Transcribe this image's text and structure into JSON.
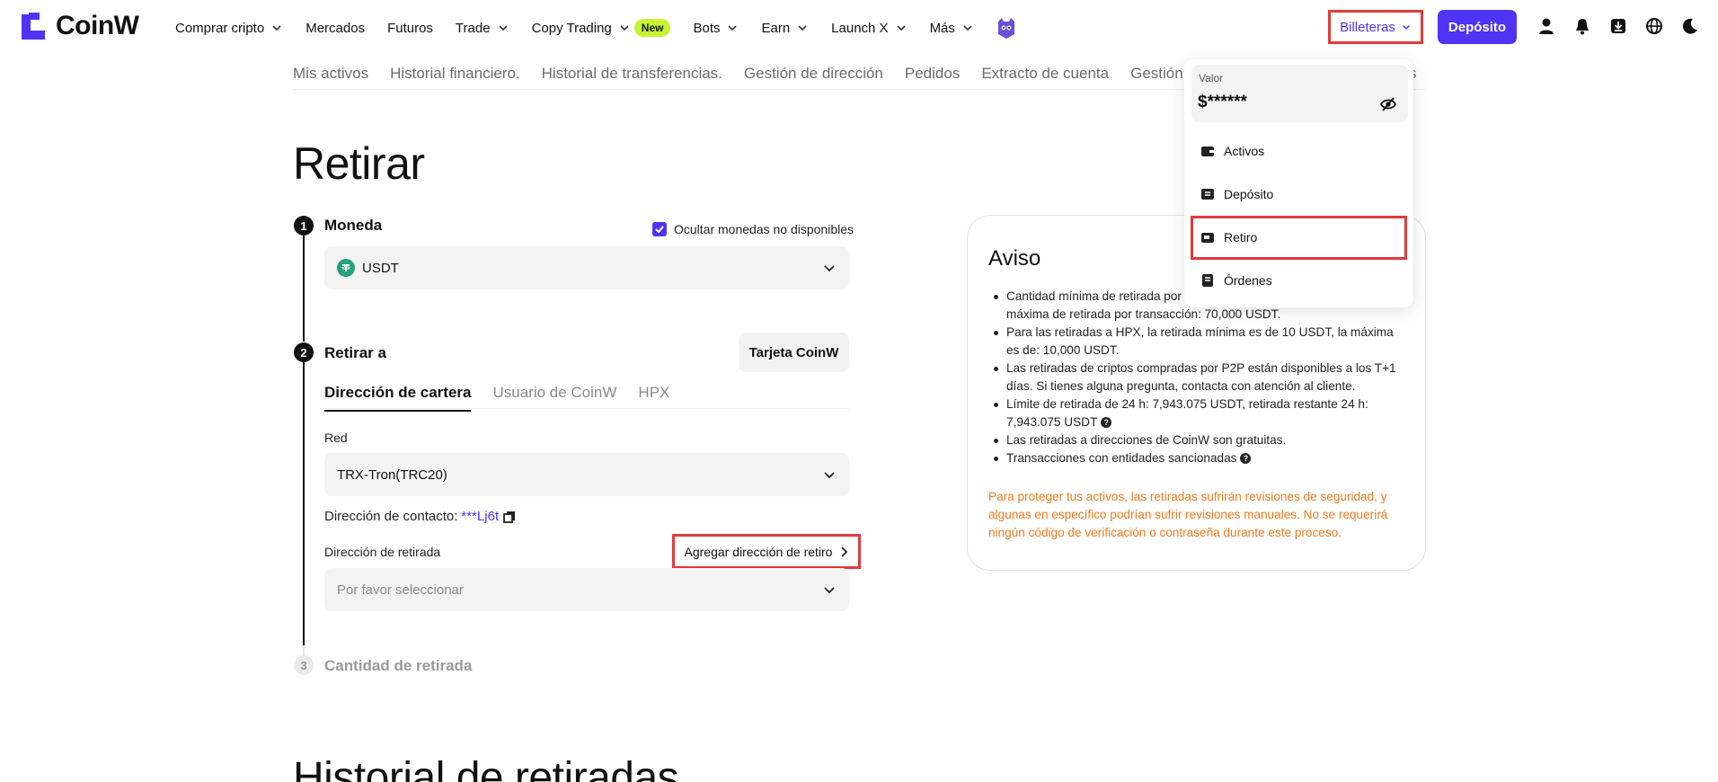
{
  "brand": {
    "name": "CoinW",
    "accent": "#4f34f5"
  },
  "nav": {
    "items": [
      {
        "label": "Comprar cripto",
        "dropdown": true
      },
      {
        "label": "Mercados",
        "dropdown": false
      },
      {
        "label": "Futuros",
        "dropdown": false
      },
      {
        "label": "Trade",
        "dropdown": true
      },
      {
        "label": "Copy Trading",
        "dropdown": true,
        "badge": "New"
      },
      {
        "label": "Bots",
        "dropdown": true
      },
      {
        "label": "Earn",
        "dropdown": true
      },
      {
        "label": "Launch X",
        "dropdown": true
      },
      {
        "label": "Más",
        "dropdown": true
      }
    ],
    "wallets_label": "Billeteras",
    "deposit_label": "Depósito",
    "icons": [
      "user-icon",
      "bell-icon",
      "download-icon",
      "globe-icon",
      "moon-icon"
    ]
  },
  "subnav": {
    "items": [
      "Mis activos",
      "Historial financiero.",
      "Historial de transferencias.",
      "Gestión de dirección",
      "Pedidos",
      "Extracto de cuenta",
      "Gestión d"
    ],
    "trailing": "s"
  },
  "page": {
    "title": "Retirar"
  },
  "step1": {
    "number": "1",
    "title": "Moneda",
    "hide_unavailable_label": "Ocultar monedas no disponibles",
    "hide_unavailable_checked": true,
    "coin": "USDT"
  },
  "step2": {
    "number": "2",
    "title": "Retirar a",
    "card_button": "Tarjeta CoinW",
    "tabs": [
      "Dirección de cartera",
      "Usuario de CoinW",
      "HPX"
    ],
    "active_tab": "Dirección de cartera",
    "network_label": "Red",
    "network_value": "TRX-Tron(TRC20)",
    "contact_label": "Dirección de contacto:",
    "contact_value": "***Lj6t",
    "withdraw_address_label": "Dirección de retirada",
    "add_address_label": "Agregar dirección de retiro",
    "withdraw_address_placeholder": "Por favor seleccionar"
  },
  "step3": {
    "number": "3",
    "title": "Cantidad de retirada"
  },
  "notice": {
    "title": "Aviso",
    "items": [
      "Cantidad mínima de retirada por",
      "máxima de retirada por transacción: 70,000 USDT.",
      "Para las retiradas a HPX, la retirada mínima es de 10 USDT, la máxima es de: 10,000 USDT.",
      "Las retiradas de criptos compradas por P2P están disponibles a los T+1 días. Si tienes alguna pregunta, contacta con atención al cliente.",
      "Límite de retirada de 24 h: 7,943.075 USDT, retirada restante 24 h: 7,943.075 USDT",
      "Las retiradas a direcciones de CoinW son gratuitas.",
      "Transacciones con entidades sancionadas"
    ],
    "warning": "Para proteger tus activos, las retiradas sufrirán revisiones de seguridad, y algunas en específico podrían sufrir revisiones manuales. No se requerirá ningún código de verificación o contraseña durante este proceso."
  },
  "wallet_menu": {
    "balance_label": "Valor",
    "balance_value": "$******",
    "items": [
      "Activos",
      "Depósito",
      "Retiro",
      "Órdenes"
    ],
    "highlighted": "Retiro"
  },
  "history": {
    "title": "Historial de retiradas"
  }
}
